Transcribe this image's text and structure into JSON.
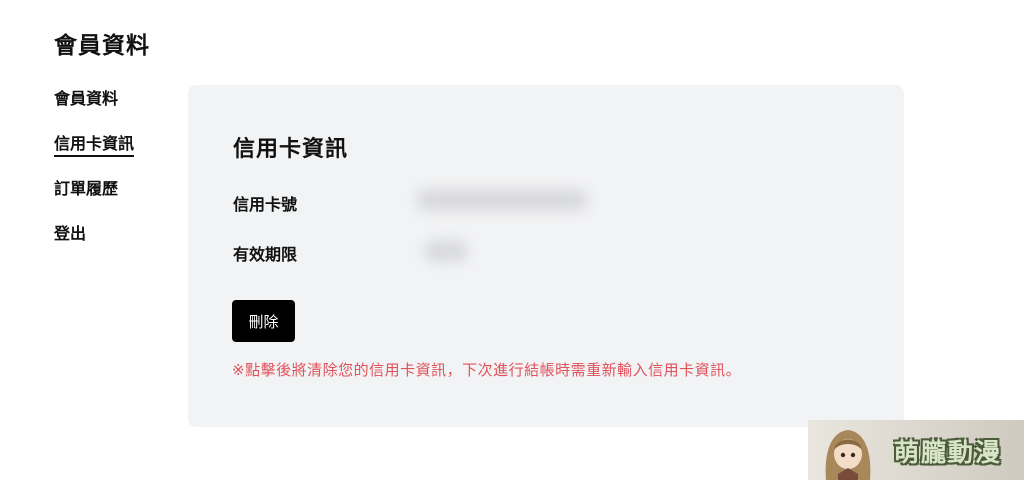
{
  "header": {
    "title": "會員資料"
  },
  "sidebar": {
    "items": [
      {
        "label": "會員資料",
        "active": false
      },
      {
        "label": "信用卡資訊",
        "active": true
      },
      {
        "label": "訂單履歷",
        "active": false
      },
      {
        "label": "登出",
        "active": false
      }
    ]
  },
  "card": {
    "title": "信用卡資訊",
    "fields": [
      {
        "label": "信用卡號",
        "value": null
      },
      {
        "label": "有效期限",
        "value": null
      }
    ],
    "delete_label": "刪除",
    "warning": "※點擊後將清除您的信用卡資訊，下次進行結帳時需重新輸入信用卡資訊。"
  },
  "watermark": {
    "text": "萌朧動漫"
  },
  "colors": {
    "background": "#ffffff",
    "card_background": "#f2f3f4",
    "button_background": "#000000",
    "warning_text": "#e0525b"
  }
}
